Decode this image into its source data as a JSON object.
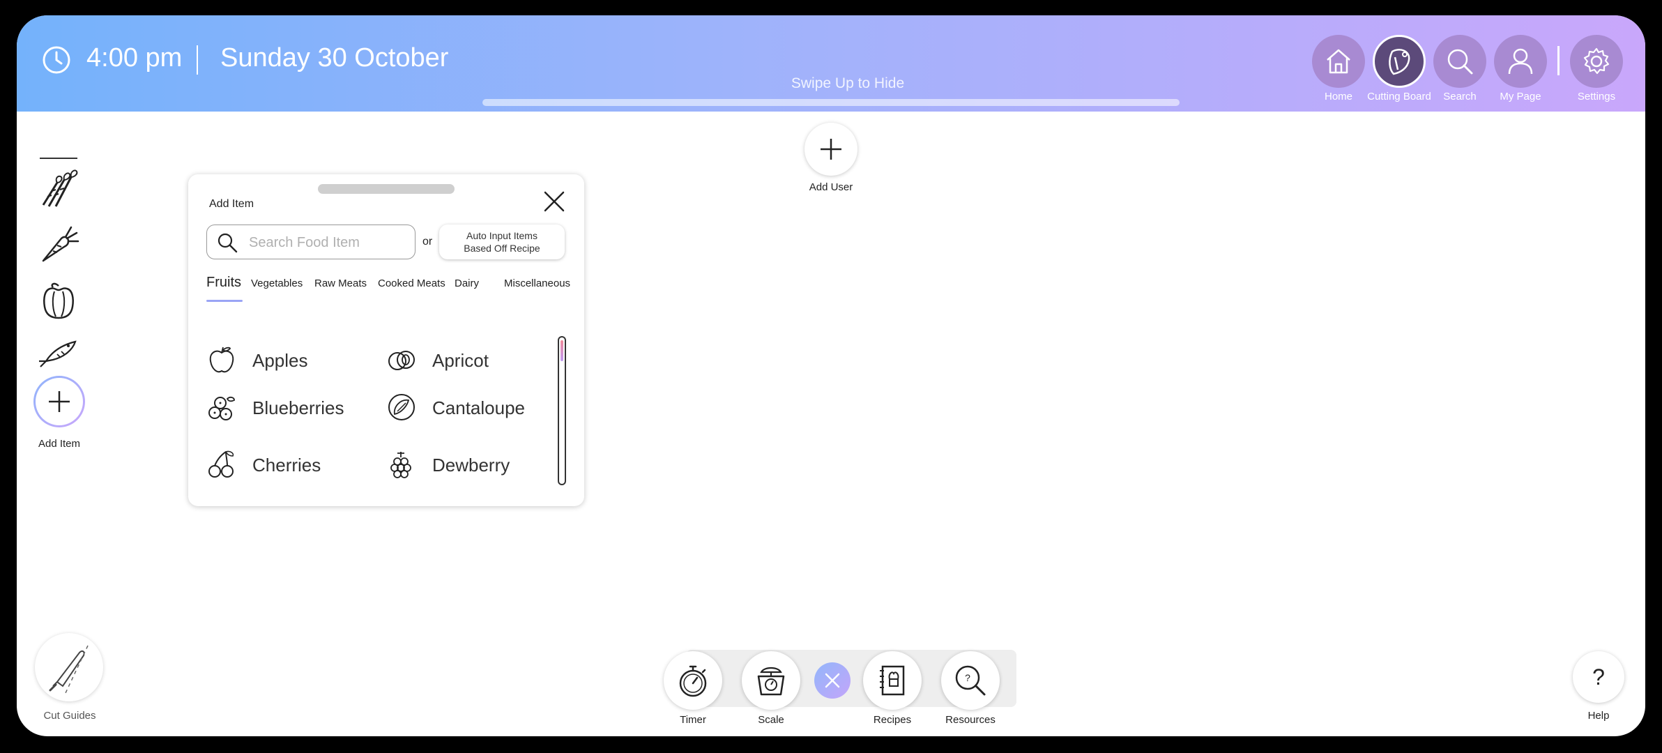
{
  "header": {
    "time": "4:00 pm",
    "date": "Sunday 30 October",
    "swipe_hint": "Swipe Up to Hide",
    "nav": [
      {
        "label": "Home",
        "icon": "home-icon"
      },
      {
        "label": "Cutting Board",
        "icon": "cutting-board-icon",
        "active": true
      },
      {
        "label": "Search",
        "icon": "search-icon"
      },
      {
        "label": "My Page",
        "icon": "user-icon"
      },
      {
        "label": "Settings",
        "icon": "gear-icon"
      }
    ],
    "gradient": [
      "#74b2fb",
      "#c9a7fb"
    ]
  },
  "add_user": {
    "label": "Add User"
  },
  "rail": {
    "items": [
      "asparagus-icon",
      "carrot-icon",
      "bell-pepper-icon",
      "fish-icon"
    ],
    "add_label": "Add Item"
  },
  "panel": {
    "title": "Add Item",
    "search_placeholder": "Search Food Item",
    "or": "or",
    "auto_line1": "Auto Input Items",
    "auto_line2": "Based Off Recipe",
    "categories": [
      "Fruits",
      "Vegetables",
      "Raw Meats",
      "Cooked Meats",
      "Dairy",
      "Miscellaneous"
    ],
    "active_category": "Fruits",
    "items": [
      {
        "name": "Apples",
        "icon": "apple-icon"
      },
      {
        "name": "Apricot",
        "icon": "apricot-icon"
      },
      {
        "name": "Blueberries",
        "icon": "blueberries-icon"
      },
      {
        "name": "Cantaloupe",
        "icon": "cantaloupe-icon"
      },
      {
        "name": "Cherries",
        "icon": "cherries-icon"
      },
      {
        "name": "Dewberry",
        "icon": "dewberry-icon"
      }
    ]
  },
  "tools": [
    {
      "label": "Timer",
      "icon": "stopwatch-icon"
    },
    {
      "label": "Scale",
      "icon": "scale-icon"
    },
    {
      "label": "Recipes",
      "icon": "recipe-book-icon"
    },
    {
      "label": "Resources",
      "icon": "resources-search-icon"
    }
  ],
  "cut_guides": {
    "label": "Cut Guides"
  },
  "help": {
    "symbol": "?",
    "label": "Help"
  }
}
